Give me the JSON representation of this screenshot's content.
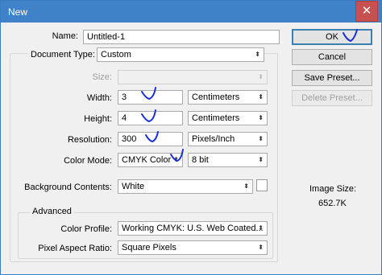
{
  "window": {
    "title": "New",
    "close_glyph": "✕"
  },
  "form": {
    "name": {
      "label": "Name:",
      "value": "Untitled-1"
    },
    "document_type": {
      "label": "Document Type:",
      "value": "Custom"
    },
    "size": {
      "label": "Size:",
      "value": ""
    },
    "width": {
      "label": "Width:",
      "value": "3",
      "unit": "Centimeters"
    },
    "height": {
      "label": "Height:",
      "value": "4",
      "unit": "Centimeters"
    },
    "resolution": {
      "label": "Resolution:",
      "value": "300",
      "unit": "Pixels/Inch"
    },
    "color_mode": {
      "label": "Color Mode:",
      "value": "CMYK Color",
      "depth": "8 bit"
    },
    "background": {
      "label": "Background Contents:",
      "value": "White"
    },
    "advanced": {
      "title": "Advanced",
      "color_profile": {
        "label": "Color Profile:",
        "value": "Working CMYK:  U.S. Web Coated..."
      },
      "pixel_aspect": {
        "label": "Pixel Aspect Ratio:",
        "value": "Square Pixels"
      }
    }
  },
  "buttons": {
    "ok": "OK",
    "cancel": "Cancel",
    "save_preset": "Save Preset...",
    "delete_preset": "Delete Preset..."
  },
  "image_size": {
    "label": "Image Size:",
    "value": "652.7K"
  },
  "icons": {
    "dropdown": "chevron-updown-icon",
    "annotation": "handwritten-checkmark-icon"
  },
  "colors": {
    "titlebar": "#3f82c8",
    "close": "#c75050",
    "ok_border": "#3c7fb1",
    "ink": "#1a2fd6"
  }
}
